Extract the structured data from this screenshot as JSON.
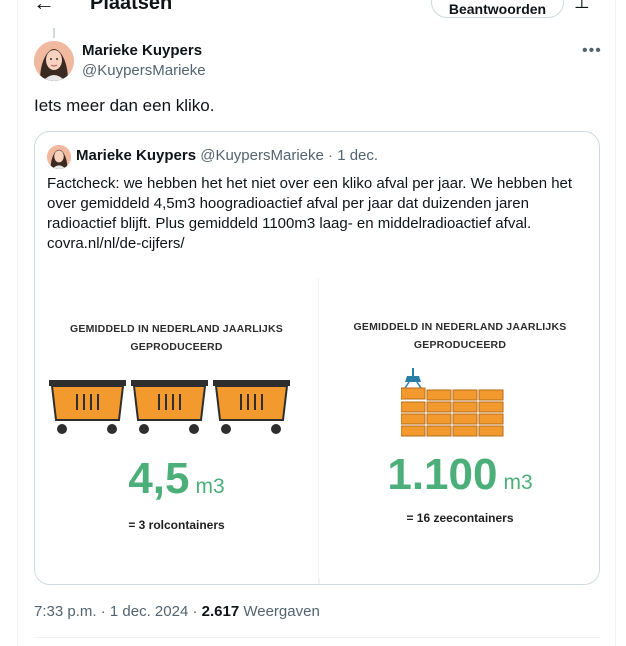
{
  "header": {
    "title": "Plaatsen",
    "reply_label": "Beantwoorden",
    "back_icon": "arrow-left-icon",
    "adjust_icon": "adjust-icon"
  },
  "tweet": {
    "name": "Marieke Kuypers",
    "handle": "@KuypersMarieke",
    "text": "Iets meer dan een kliko.",
    "time": "7:33 p.m.",
    "date": "1 dec. 2024",
    "views_count": "2.617",
    "views_label": "Weergaven"
  },
  "quote": {
    "name": "Marieke Kuypers",
    "handle": "@KuypersMarieke",
    "date": "1 dec.",
    "text": "Factcheck: we hebben het het niet over een kliko afval per jaar. We hebben het over gemiddeld 4,5m3 hoogradioactief afval per jaar dat duizenden jaren radioactief blijft. Plus gemiddeld 1100m3 laag- en middelradioactief afval. covra.nl/nl/de-cijfers/",
    "panel1": {
      "title_line1": "GEMIDDELD IN NEDERLAND JAARLIJKS",
      "title_line2": "GEPRODUCEERD",
      "number": "4,5",
      "unit": "m3",
      "caption": "= 3 rolcontainers"
    },
    "panel2": {
      "title_line1": "GEMIDDELD IN NEDERLAND JAARLIJKS",
      "title_line2": "GEPRODUCEERD",
      "number": "1.100",
      "unit": "m3",
      "caption": "= 16 zeecontainers"
    }
  },
  "colors": {
    "accent_green": "#4caf7a",
    "container_orange": "#f29a2e",
    "border": "#cfd9de"
  }
}
